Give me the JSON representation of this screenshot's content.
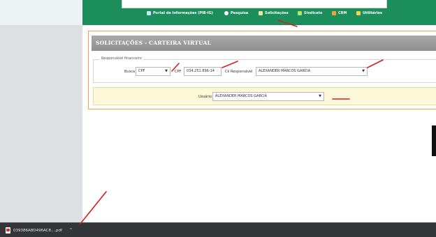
{
  "nav": {
    "items": [
      {
        "label": "Portal de Informações (PIB-IG)",
        "icon": "portal-icon"
      },
      {
        "label": "Pesquisa",
        "icon": "search-icon"
      },
      {
        "label": "Solicitações",
        "icon": "person-icon"
      },
      {
        "label": "Sindicato",
        "icon": "leaf-icon"
      },
      {
        "label": "CRM",
        "icon": "crm-icon"
      },
      {
        "label": "Utilitários",
        "icon": "tools-icon"
      }
    ]
  },
  "panel": {
    "title": "SOLICITAÇÕES - CARTEIRA VIRTUAL",
    "fieldset_legend": "Responsável financeiro",
    "busca_label": "Busca",
    "busca_value": "CPF",
    "cpf_label": "CPF",
    "cpf_value": "034.251.896-14",
    "responsavel_label": "Ck Responsável",
    "responsavel_value": "ALEXANDER MARCOS GARCIA",
    "usuario_label": "Usuário",
    "usuario_value": "ALEXANDER MARCOS GARCIA"
  },
  "download": {
    "filename": "039386A8D496AC8....pdf",
    "chevron": "^"
  },
  "colors": {
    "nav_green": "#1b8e5c",
    "panel_border": "#e6a951",
    "arrow_red": "#d0211c",
    "user_box_bg": "#fdf8d8"
  }
}
